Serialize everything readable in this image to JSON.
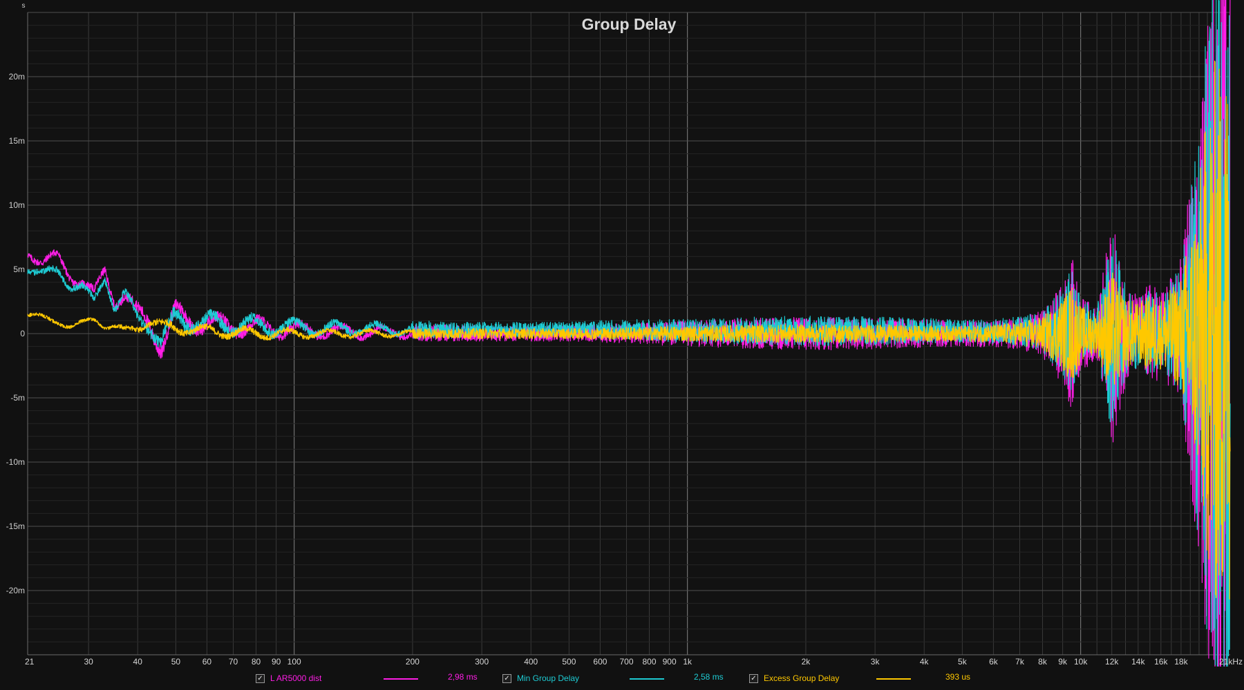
{
  "chart_data": {
    "type": "line",
    "title": "Group Delay",
    "y_unit_label": "s",
    "x_unit_suffix": "kHz",
    "x_scale": "log",
    "xlim": [
      21,
      24000
    ],
    "ylim": [
      -0.025,
      0.025
    ],
    "grid": true,
    "x_tick_labels": [
      {
        "v": 21,
        "t": "21"
      },
      {
        "v": 30,
        "t": "30"
      },
      {
        "v": 40,
        "t": "40"
      },
      {
        "v": 50,
        "t": "50"
      },
      {
        "v": 60,
        "t": "60"
      },
      {
        "v": 70,
        "t": "70"
      },
      {
        "v": 80,
        "t": "80"
      },
      {
        "v": 90,
        "t": "90"
      },
      {
        "v": 100,
        "t": "100"
      },
      {
        "v": 200,
        "t": "200"
      },
      {
        "v": 300,
        "t": "300"
      },
      {
        "v": 400,
        "t": "400"
      },
      {
        "v": 500,
        "t": "500"
      },
      {
        "v": 600,
        "t": "600"
      },
      {
        "v": 700,
        "t": "700"
      },
      {
        "v": 800,
        "t": "800"
      },
      {
        "v": 900,
        "t": "900"
      },
      {
        "v": 1000,
        "t": "1k"
      },
      {
        "v": 2000,
        "t": "2k"
      },
      {
        "v": 3000,
        "t": "3k"
      },
      {
        "v": 4000,
        "t": "4k"
      },
      {
        "v": 5000,
        "t": "5k"
      },
      {
        "v": 6000,
        "t": "6k"
      },
      {
        "v": 7000,
        "t": "7k"
      },
      {
        "v": 8000,
        "t": "8k"
      },
      {
        "v": 9000,
        "t": "9k"
      },
      {
        "v": 10000,
        "t": "10k"
      },
      {
        "v": 12000,
        "t": "12k"
      },
      {
        "v": 14000,
        "t": "14k"
      },
      {
        "v": 16000,
        "t": "16k"
      },
      {
        "v": 18000,
        "t": "18k"
      },
      {
        "v": 21000,
        "t": "21kHz"
      }
    ],
    "y_tick_labels": [
      {
        "v": 0.02,
        "t": "20m"
      },
      {
        "v": 0.015,
        "t": "15m"
      },
      {
        "v": 0.01,
        "t": "10m"
      },
      {
        "v": 0.005,
        "t": "5m"
      },
      {
        "v": 0,
        "t": "0"
      },
      {
        "v": -0.005,
        "t": "-5m"
      },
      {
        "v": -0.01,
        "t": "-10m"
      },
      {
        "v": -0.015,
        "t": "-15m"
      },
      {
        "v": -0.02,
        "t": "-20m"
      }
    ],
    "series": [
      {
        "name": "L AR5000 dist",
        "color": "#ff1ee6",
        "value_label": "2,98 ms",
        "x": [
          21,
          23,
          25,
          27,
          29,
          31,
          33,
          35,
          37,
          40,
          43,
          46,
          50,
          55,
          60,
          70,
          80,
          90,
          100,
          120,
          150,
          200,
          300,
          500,
          700,
          1000,
          1500,
          2000,
          3000,
          4000,
          5000,
          6000,
          7000,
          8000,
          9000,
          9500,
          10000,
          11000,
          12000,
          13000,
          14000,
          15000,
          16000,
          17000,
          18000,
          19000,
          20000,
          21000,
          22000,
          24000
        ],
        "y": [
          0.0065,
          0.0055,
          0.006,
          0.0045,
          0.004,
          0.003,
          0.005,
          0.0025,
          0.003,
          0.0015,
          0.001,
          -0.001,
          0.0015,
          0.001,
          0.0008,
          0.0006,
          0.0005,
          0.0004,
          0.0003,
          0.0002,
          0.0001,
          0.0001,
          0.0,
          0.0,
          0.0,
          0.0,
          0.0,
          0.0,
          0.0,
          0.0,
          0.0,
          0.0,
          0.0,
          0.0,
          0.0,
          0.0,
          0.0,
          0.0,
          0.0,
          0.0,
          0.0,
          0.0,
          0.0,
          0.0,
          0.0,
          0.0,
          0.0,
          0.0,
          0.0,
          0.0
        ],
        "spread": [
          0.0008,
          0.0008,
          0.0008,
          0.0008,
          0.0008,
          0.0008,
          0.0009,
          0.0009,
          0.001,
          0.0012,
          0.0015,
          0.0016,
          0.0015,
          0.0014,
          0.0013,
          0.0012,
          0.0012,
          0.0011,
          0.001,
          0.0009,
          0.0008,
          0.0007,
          0.0006,
          0.0006,
          0.0008,
          0.001,
          0.0012,
          0.0013,
          0.0012,
          0.0011,
          0.001,
          0.0011,
          0.0012,
          0.0018,
          0.004,
          0.006,
          0.003,
          0.002,
          0.009,
          0.004,
          0.003,
          0.004,
          0.0035,
          0.0045,
          0.006,
          0.012,
          0.018,
          0.025,
          0.03,
          0.03
        ]
      },
      {
        "name": "Min Group Delay",
        "color": "#1ecbd3",
        "value_label": "2,58 ms",
        "x": [
          21,
          23,
          25,
          27,
          29,
          31,
          33,
          35,
          37,
          40,
          43,
          46,
          50,
          55,
          60,
          70,
          80,
          90,
          100,
          120,
          150,
          200,
          300,
          500,
          700,
          1000,
          1500,
          2000,
          3000,
          4000,
          5000,
          6000,
          7000,
          8000,
          9000,
          9500,
          10000,
          11000,
          12000,
          13000,
          14000,
          15000,
          16000,
          17000,
          18000,
          19000,
          20000,
          21000,
          22000,
          24000
        ],
        "y": [
          0.0052,
          0.0045,
          0.005,
          0.0038,
          0.0035,
          0.0025,
          0.0045,
          0.002,
          0.003,
          0.0012,
          0.0008,
          -0.0008,
          0.0012,
          0.001,
          0.0008,
          0.0007,
          0.0006,
          0.0005,
          0.0005,
          0.0004,
          0.0004,
          0.0003,
          0.0003,
          0.0003,
          0.0003,
          0.0002,
          0.0002,
          0.0002,
          0.0002,
          0.0002,
          0.0002,
          0.0002,
          0.0002,
          0.0002,
          0.0002,
          0.0002,
          0.0002,
          0.0002,
          0.0002,
          0.0002,
          0.0002,
          0.0002,
          0.0002,
          0.0002,
          0.0002,
          0.0002,
          0.0002,
          0.0002,
          0.0002,
          0.0002
        ],
        "spread": [
          0.0007,
          0.0007,
          0.0007,
          0.0007,
          0.0007,
          0.0007,
          0.0008,
          0.0008,
          0.0009,
          0.001,
          0.0013,
          0.0015,
          0.0015,
          0.0014,
          0.0013,
          0.0012,
          0.0012,
          0.0011,
          0.001,
          0.0009,
          0.0008,
          0.0007,
          0.0006,
          0.0006,
          0.0008,
          0.0009,
          0.0011,
          0.0012,
          0.0011,
          0.001,
          0.0009,
          0.001,
          0.0011,
          0.0016,
          0.0035,
          0.005,
          0.0025,
          0.0018,
          0.008,
          0.0035,
          0.0028,
          0.0035,
          0.003,
          0.004,
          0.0055,
          0.011,
          0.017,
          0.024,
          0.03,
          0.03
        ]
      },
      {
        "name": "Excess Group Delay",
        "color": "#ffc800",
        "value_label": "393 us",
        "x": [
          21,
          23,
          25,
          27,
          29,
          31,
          33,
          35,
          37,
          40,
          43,
          46,
          50,
          55,
          60,
          70,
          80,
          90,
          100,
          120,
          150,
          200,
          300,
          500,
          700,
          1000,
          1500,
          2000,
          3000,
          4000,
          5000,
          6000,
          7000,
          8000,
          9000,
          9500,
          10000,
          11000,
          12000,
          13000,
          14000,
          15000,
          16000,
          17000,
          18000,
          19000,
          20000,
          21000,
          22000,
          24000
        ],
        "y": [
          0.0015,
          0.0012,
          0.001,
          0.0005,
          0.0008,
          0.0012,
          0.0006,
          0.0005,
          0.0002,
          0.0005,
          0.001,
          0.0005,
          0.0005,
          0.0003,
          0.0002,
          0.0001,
          0.0,
          0.0,
          0.0,
          0.0,
          0.0,
          0.0,
          0.0,
          0.0,
          0.0,
          0.0,
          0.0,
          0.0,
          0.0,
          0.0,
          0.0,
          0.0,
          0.0,
          0.0,
          0.0,
          0.0,
          0.0,
          0.0,
          0.0,
          0.0,
          0.0,
          0.0,
          0.0,
          0.0,
          0.0,
          0.0,
          0.0,
          0.0,
          0.0,
          0.0
        ],
        "spread": [
          0.0004,
          0.0004,
          0.0004,
          0.0004,
          0.0004,
          0.0004,
          0.0004,
          0.0004,
          0.0005,
          0.0006,
          0.0007,
          0.0008,
          0.0008,
          0.0007,
          0.0007,
          0.0007,
          0.0007,
          0.0006,
          0.0006,
          0.0005,
          0.0005,
          0.0004,
          0.0004,
          0.0004,
          0.0005,
          0.0006,
          0.0007,
          0.0007,
          0.0007,
          0.0006,
          0.0006,
          0.0007,
          0.0009,
          0.0013,
          0.0028,
          0.004,
          0.0022,
          0.0015,
          0.005,
          0.0028,
          0.0024,
          0.003,
          0.0028,
          0.0035,
          0.0045,
          0.008,
          0.012,
          0.018,
          0.022,
          0.022
        ]
      }
    ]
  },
  "legend": [
    {
      "checked_glyph": "✓",
      "name": "L AR5000 dist",
      "value": "2,98 ms",
      "color": "#ff1ee6"
    },
    {
      "checked_glyph": "✓",
      "name": "Min Group Delay",
      "value": "2,58 ms",
      "color": "#1ecbd3"
    },
    {
      "checked_glyph": "✓",
      "name": "Excess Group Delay",
      "value": "393 us",
      "color": "#ffc800"
    }
  ]
}
